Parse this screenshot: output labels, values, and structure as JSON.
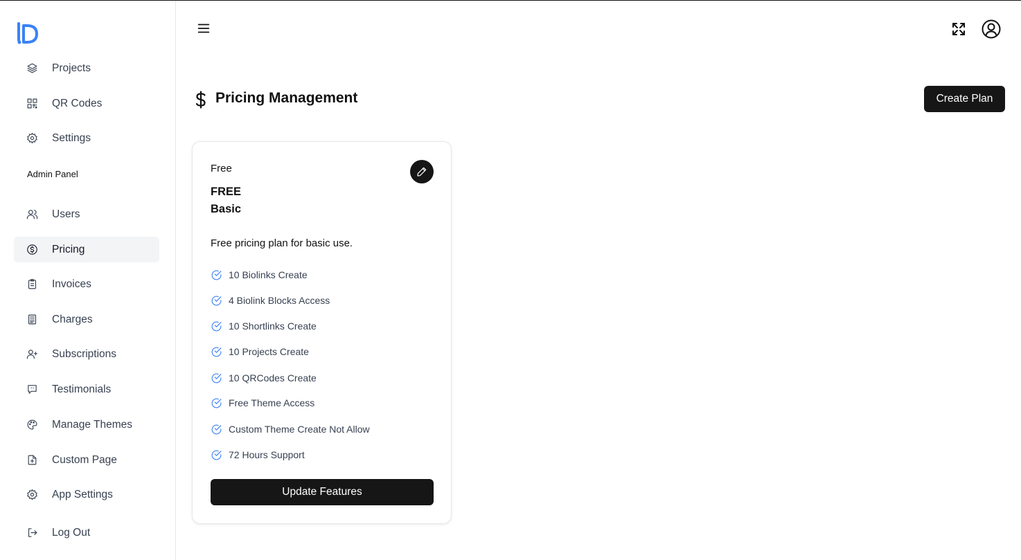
{
  "sidebar": {
    "items_top": [
      {
        "label": "Projects",
        "icon": "layers-icon"
      },
      {
        "label": "QR Codes",
        "icon": "qr-code-icon"
      },
      {
        "label": "Settings",
        "icon": "gear-icon"
      }
    ],
    "section_label": "Admin Panel",
    "items_admin": [
      {
        "label": "Users",
        "icon": "users-icon"
      },
      {
        "label": "Pricing",
        "icon": "dollar-circle-icon",
        "active": true
      },
      {
        "label": "Invoices",
        "icon": "clipboard-icon"
      },
      {
        "label": "Charges",
        "icon": "receipt-icon"
      },
      {
        "label": "Subscriptions",
        "icon": "user-plus-icon"
      },
      {
        "label": "Testimonials",
        "icon": "message-icon"
      },
      {
        "label": "Manage Themes",
        "icon": "palette-icon"
      },
      {
        "label": "Custom Page",
        "icon": "file-plus-icon"
      },
      {
        "label": "App Settings",
        "icon": "gear-icon"
      },
      {
        "label": "Log Out",
        "icon": "logout-icon"
      }
    ]
  },
  "topbar": {
    "menu_icon": "hamburger-icon",
    "expand_icon": "fullscreen-icon",
    "user_icon": "user-circle-icon"
  },
  "header": {
    "title": "Pricing Management",
    "title_icon": "dollar-icon",
    "create_button": "Create Plan"
  },
  "plans": [
    {
      "name": "Free",
      "price": "FREE",
      "tier": "Basic",
      "description": "Free pricing plan for basic use.",
      "features": [
        "10 Biolinks Create",
        "4 Biolink Blocks Access",
        "10 Shortlinks Create",
        "10 Projects Create",
        "10 QRCodes Create",
        "Free Theme Access",
        "Custom Theme Create Not Allow",
        "72 Hours Support"
      ],
      "update_button": "Update Features"
    }
  ],
  "colors": {
    "accent": "#3b82f6",
    "primary_button": "#161616",
    "active_nav_bg": "#f3f4f6"
  }
}
